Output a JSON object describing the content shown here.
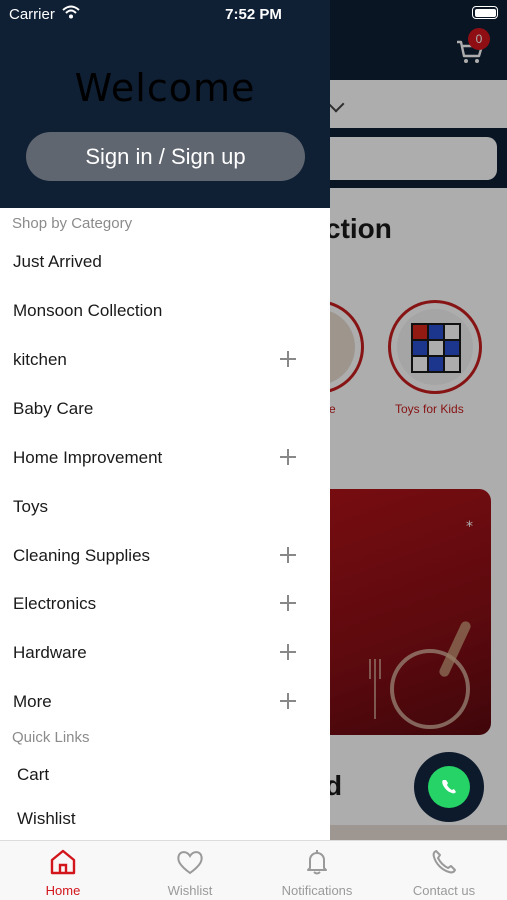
{
  "status_bar": {
    "carrier": "Carrier",
    "time": "7:52 PM"
  },
  "background": {
    "cart_count": "0",
    "section_title_partial": "ction",
    "categories": [
      {
        "label_partial": "re"
      },
      {
        "label": "Toys for Kids"
      }
    ],
    "section_title2_partial": "d"
  },
  "drawer": {
    "welcome": "Welcome",
    "signin_button": "Sign in / Sign up",
    "shop_by_category": "Shop by Category",
    "categories": [
      {
        "label": "Just Arrived",
        "expandable": false
      },
      {
        "label": "Monsoon Collection",
        "expandable": false
      },
      {
        "label": "kitchen",
        "expandable": true
      },
      {
        "label": "Baby Care",
        "expandable": false
      },
      {
        "label": "Home Improvement",
        "expandable": true
      },
      {
        "label": "Toys",
        "expandable": false
      },
      {
        "label": "Cleaning Supplies",
        "expandable": true
      },
      {
        "label": "Electronics",
        "expandable": true
      },
      {
        "label": "Hardware",
        "expandable": true
      },
      {
        "label": "More",
        "expandable": true
      }
    ],
    "quick_links_heading": "Quick Links",
    "quick_links": [
      {
        "label": "Cart"
      },
      {
        "label": "Wishlist"
      }
    ]
  },
  "tabbar": {
    "tabs": [
      {
        "label": "Home",
        "icon": "home-icon",
        "active": true
      },
      {
        "label": "Wishlist",
        "icon": "heart-icon",
        "active": false
      },
      {
        "label": "Notifications",
        "icon": "bell-icon",
        "active": false
      },
      {
        "label": "Contact us",
        "icon": "phone-icon",
        "active": false
      }
    ]
  },
  "colors": {
    "navy": "#0f1f34",
    "accent_red": "#d2161c",
    "whatsapp_green": "#25d366"
  }
}
